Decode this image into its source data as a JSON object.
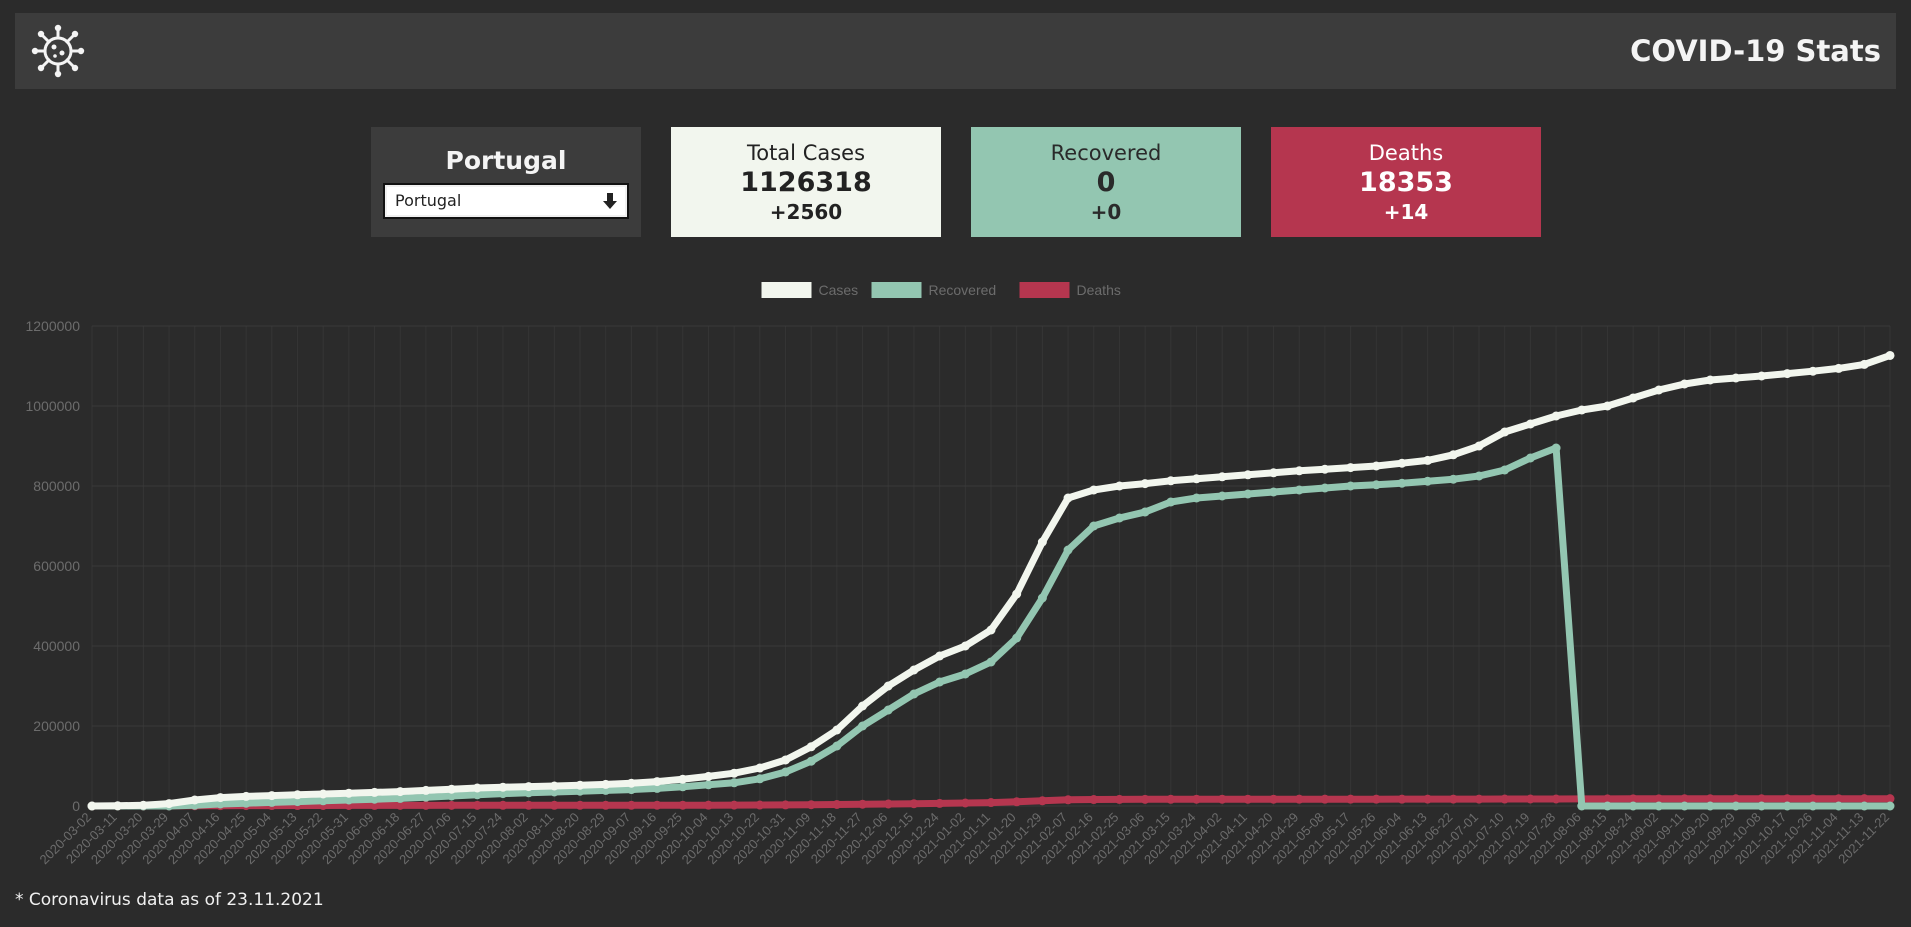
{
  "header": {
    "title": "COVID-19 Stats",
    "logo_icon": "virus-icon"
  },
  "country_card": {
    "title": "Portugal",
    "select_value": "Portugal",
    "select_icon": "arrow-down-icon"
  },
  "stats": {
    "total_cases": {
      "label": "Total Cases",
      "value": "1126318",
      "delta": "+2560",
      "color": "#f2f6ee"
    },
    "recovered": {
      "label": "Recovered",
      "value": "0",
      "delta": "+0",
      "color": "#93c6b1"
    },
    "deaths": {
      "label": "Deaths",
      "value": "18353",
      "delta": "+14",
      "color": "#b5364f"
    }
  },
  "footnote": "* Coronavirus data as of 23.11.2021",
  "chart_data": {
    "type": "line",
    "legend_placement": "top-center",
    "grid": true,
    "ylim": [
      0,
      1200000
    ],
    "y_ticks": [
      "1200000",
      "1000000",
      "800000",
      "600000",
      "400000",
      "200000",
      "0"
    ],
    "x_tick_labels": [
      "2020-03-02",
      "2020-03-11",
      "2020-03-20",
      "2020-03-29",
      "2020-04-07",
      "2020-04-16",
      "2020-04-25",
      "2020-05-04",
      "2020-05-13",
      "2020-05-22",
      "2020-05-31",
      "2020-06-09",
      "2020-06-18",
      "2020-06-27",
      "2020-07-06",
      "2020-07-15",
      "2020-07-24",
      "2020-08-02",
      "2020-08-11",
      "2020-08-20",
      "2020-08-29",
      "2020-09-07",
      "2020-09-16",
      "2020-09-25",
      "2020-10-04",
      "2020-10-13",
      "2020-10-22",
      "2020-10-31",
      "2020-11-09",
      "2020-11-18",
      "2020-11-27",
      "2020-12-06",
      "2020-12-15",
      "2020-12-24",
      "2021-01-02",
      "2021-01-11",
      "2021-01-20",
      "2021-01-29",
      "2021-02-07",
      "2021-02-16",
      "2021-02-25",
      "2021-03-06",
      "2021-03-15",
      "2021-03-24",
      "2021-04-02",
      "2021-04-11",
      "2021-04-20",
      "2021-04-29",
      "2021-05-08",
      "2021-05-17",
      "2021-05-26",
      "2021-06-04",
      "2021-06-13",
      "2021-06-22",
      "2021-07-01",
      "2021-07-10",
      "2021-07-19",
      "2021-07-28",
      "2021-08-06",
      "2021-08-15",
      "2021-08-24",
      "2021-09-02",
      "2021-09-11",
      "2021-09-20",
      "2021-09-29",
      "2021-10-08",
      "2021-10-17",
      "2021-10-26",
      "2021-11-04",
      "2021-11-13",
      "2021-11-22"
    ],
    "series": [
      {
        "name": "Cases",
        "color": "#f2f6ee",
        "values": [
          0,
          500,
          2000,
          6000,
          15000,
          21000,
          24000,
          26000,
          28000,
          30000,
          32000,
          34000,
          36000,
          39000,
          42000,
          45000,
          47000,
          48500,
          50000,
          52000,
          54000,
          57000,
          61000,
          67000,
          74000,
          82000,
          95000,
          115000,
          148000,
          190000,
          250000,
          300000,
          340000,
          375000,
          400000,
          440000,
          530000,
          660000,
          770000,
          790000,
          800000,
          806000,
          813000,
          818000,
          823000,
          828000,
          833000,
          838000,
          842000,
          846000,
          850000,
          857000,
          864000,
          878000,
          900000,
          935000,
          955000,
          975000,
          990000,
          1000000,
          1020000,
          1040000,
          1055000,
          1065000,
          1070000,
          1075000,
          1081000,
          1087000,
          1094000,
          1104000,
          1126318
        ]
      },
      {
        "name": "Recovered",
        "color": "#93c6b1",
        "values": [
          0,
          0,
          0,
          0,
          2000,
          5000,
          7000,
          9000,
          11000,
          13000,
          15000,
          17000,
          19000,
          22000,
          25000,
          28000,
          31000,
          33000,
          35000,
          37000,
          39000,
          41000,
          44000,
          48000,
          53000,
          58000,
          68000,
          85000,
          112000,
          150000,
          200000,
          240000,
          280000,
          310000,
          330000,
          360000,
          420000,
          520000,
          640000,
          700000,
          720000,
          735000,
          760000,
          770000,
          775000,
          780000,
          785000,
          790000,
          795000,
          800000,
          803000,
          807000,
          812000,
          817000,
          825000,
          840000,
          870000,
          895000,
          0,
          0,
          0,
          0,
          0,
          0,
          0,
          0,
          0,
          0,
          0,
          0,
          0
        ]
      },
      {
        "name": "Deaths",
        "color": "#b5364f",
        "values": [
          0,
          0,
          100,
          300,
          600,
          800,
          1000,
          1100,
          1200,
          1300,
          1400,
          1500,
          1550,
          1600,
          1650,
          1700,
          1750,
          1780,
          1800,
          1820,
          1840,
          1860,
          1900,
          1950,
          2050,
          2200,
          2400,
          2700,
          3200,
          3800,
          4400,
          5000,
          5700,
          6500,
          7500,
          8600,
          10500,
          13000,
          15500,
          16200,
          16500,
          16700,
          16800,
          16900,
          16950,
          17000,
          17000,
          17050,
          17050,
          17100,
          17100,
          17150,
          17200,
          17250,
          17300,
          17400,
          17500,
          17600,
          17700,
          17800,
          17900,
          17950,
          18000,
          18050,
          18100,
          18120,
          18150,
          18200,
          18250,
          18300,
          18353
        ]
      }
    ]
  }
}
